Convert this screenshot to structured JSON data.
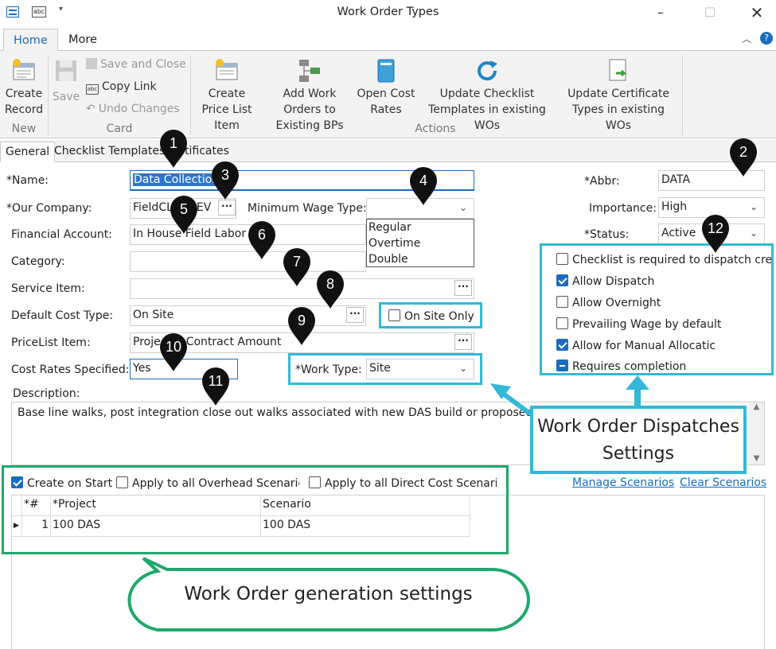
{
  "window": {
    "title": "Work Order Types"
  },
  "ribbon_tabs": [
    {
      "label": "Home"
    },
    {
      "label": "More"
    }
  ],
  "ribbon": {
    "new_group": {
      "label": "New",
      "create_record": "Create Record"
    },
    "card_group": {
      "label": "Card",
      "save": "Save",
      "save_and_close": "Save and Close",
      "copy_link": "Copy Link",
      "undo_changes": "Undo Changes"
    },
    "actions_group": {
      "label": "Actions",
      "create_price_list_item": "Create Price List Item",
      "add_work_orders": "Add Work Orders to Existing BPs",
      "open_cost_rates": "Open Cost Rates",
      "update_checklist": "Update Checklist Templates in existing WOs",
      "update_certificate": "Update Certificate Types in existing WOs"
    }
  },
  "form_tabs": [
    {
      "label": "General"
    },
    {
      "label": "Checklist Templates"
    },
    {
      "label": "tificates"
    }
  ],
  "form": {
    "name": {
      "label": "*Name:",
      "value": "Data Collection"
    },
    "our_company": {
      "label": "*Our Company:",
      "value": "FieldCL",
      "value_suffix": "EV"
    },
    "minimum_wage_type": {
      "label": "Minimum Wage Type:",
      "value": "",
      "options": [
        "Regular",
        "Overtime",
        "Double"
      ]
    },
    "financial_account": {
      "label": "Financial Account:",
      "value": "In House Field Labor"
    },
    "category": {
      "label": "Category:",
      "value": ""
    },
    "service_item": {
      "label": "Service Item:",
      "value": ""
    },
    "default_cost_type": {
      "label": "Default Cost Type:",
      "value": "On Site"
    },
    "on_site_only": {
      "label": "On Site Only",
      "checked": false
    },
    "pricelist_item": {
      "label": "PriceList Item:",
      "value_a": "Proje",
      "value_b": "Contract Amount"
    },
    "cost_rates_specified": {
      "label": "Cost Rates Specified:",
      "value": "Yes"
    },
    "work_type": {
      "label": "*Work Type:",
      "value": "Site"
    },
    "description": {
      "label": "Description:",
      "value": "Base line walks, post integration close out walks associated with new DAS build or proposed buil"
    },
    "abbr": {
      "label": "*Abbr:",
      "value": "DATA"
    },
    "importance": {
      "label": "Importance:",
      "value": "High"
    },
    "status": {
      "label": "*Status:",
      "value": "Active"
    }
  },
  "dispatch_settings": [
    {
      "label": "Checklist is required to dispatch crew",
      "checked": false
    },
    {
      "label": "Allow Dispatch",
      "checked": true
    },
    {
      "label": "Allow Overnight",
      "checked": false
    },
    {
      "label": "Prevailing Wage by default",
      "checked": false
    },
    {
      "label": "Allow for Manual Allocatic",
      "checked": true
    },
    {
      "label": "Requires completion",
      "checked": "indeterminate"
    }
  ],
  "generation": {
    "create_on_start": {
      "label": "Create on Start",
      "checked": true
    },
    "apply_overhead": {
      "label": "Apply to all Overhead Scenarios",
      "checked": false
    },
    "apply_direct": {
      "label": "Apply to all Direct Cost Scenario",
      "checked": false
    },
    "manage_scenarios": "Manage Scenarios",
    "clear_scenarios": "Clear Scenarios",
    "grid": {
      "headers": [
        "*#",
        "*Project",
        "Scenario"
      ],
      "rows": [
        {
          "num": "1",
          "project": "100 DAS",
          "scenario": "100 DAS"
        }
      ]
    }
  },
  "callouts": {
    "dispatch": "Work Order Dispatches Settings",
    "generation": "Work Order generation settings"
  },
  "markers": [
    "1",
    "2",
    "3",
    "4",
    "5",
    "6",
    "7",
    "8",
    "9",
    "10",
    "11",
    "12"
  ],
  "colors": {
    "accent": "#1b6cbf",
    "callout_cyan": "#33b8d8",
    "callout_green": "#1fa86b",
    "marker": "#111111"
  }
}
